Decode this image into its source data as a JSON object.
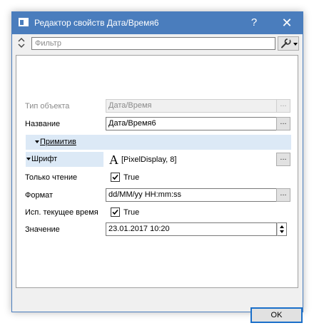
{
  "window": {
    "title": "Редактор свойств Дата/Время6",
    "help_label": "?",
    "close_label": "✕"
  },
  "toolbar": {
    "filter_placeholder": "Фильтр",
    "tool_icon": "wrench-icon",
    "tool_dropdown_icon": "chevron-down-icon"
  },
  "properties": {
    "object_type": {
      "label": "Тип объекта",
      "value": "Дата/Время",
      "button": "..."
    },
    "name": {
      "label": "Название",
      "value": "Дата/Время6",
      "button": "..."
    },
    "primitive_group": {
      "label": "Примитив"
    },
    "font": {
      "label": "Шрифт",
      "glyph": "A",
      "value": "[PixelDisplay, 8]",
      "button": "..."
    },
    "readonly": {
      "label": "Только чтение",
      "checked": true,
      "value": "True"
    },
    "format": {
      "label": "Формат",
      "value": "dd/MM/yy HH:mm:ss",
      "button": "..."
    },
    "use_current_time": {
      "label": "Исп. текущее время",
      "checked": true,
      "value": "True"
    },
    "value": {
      "label": "Значение",
      "value": "23.01.2017 10:20"
    }
  },
  "footer": {
    "ok_label": "OK"
  },
  "colors": {
    "title_bar": "#4a7dbd",
    "group_band": "#dce9f6",
    "ok_border": "#1a6fc9"
  }
}
